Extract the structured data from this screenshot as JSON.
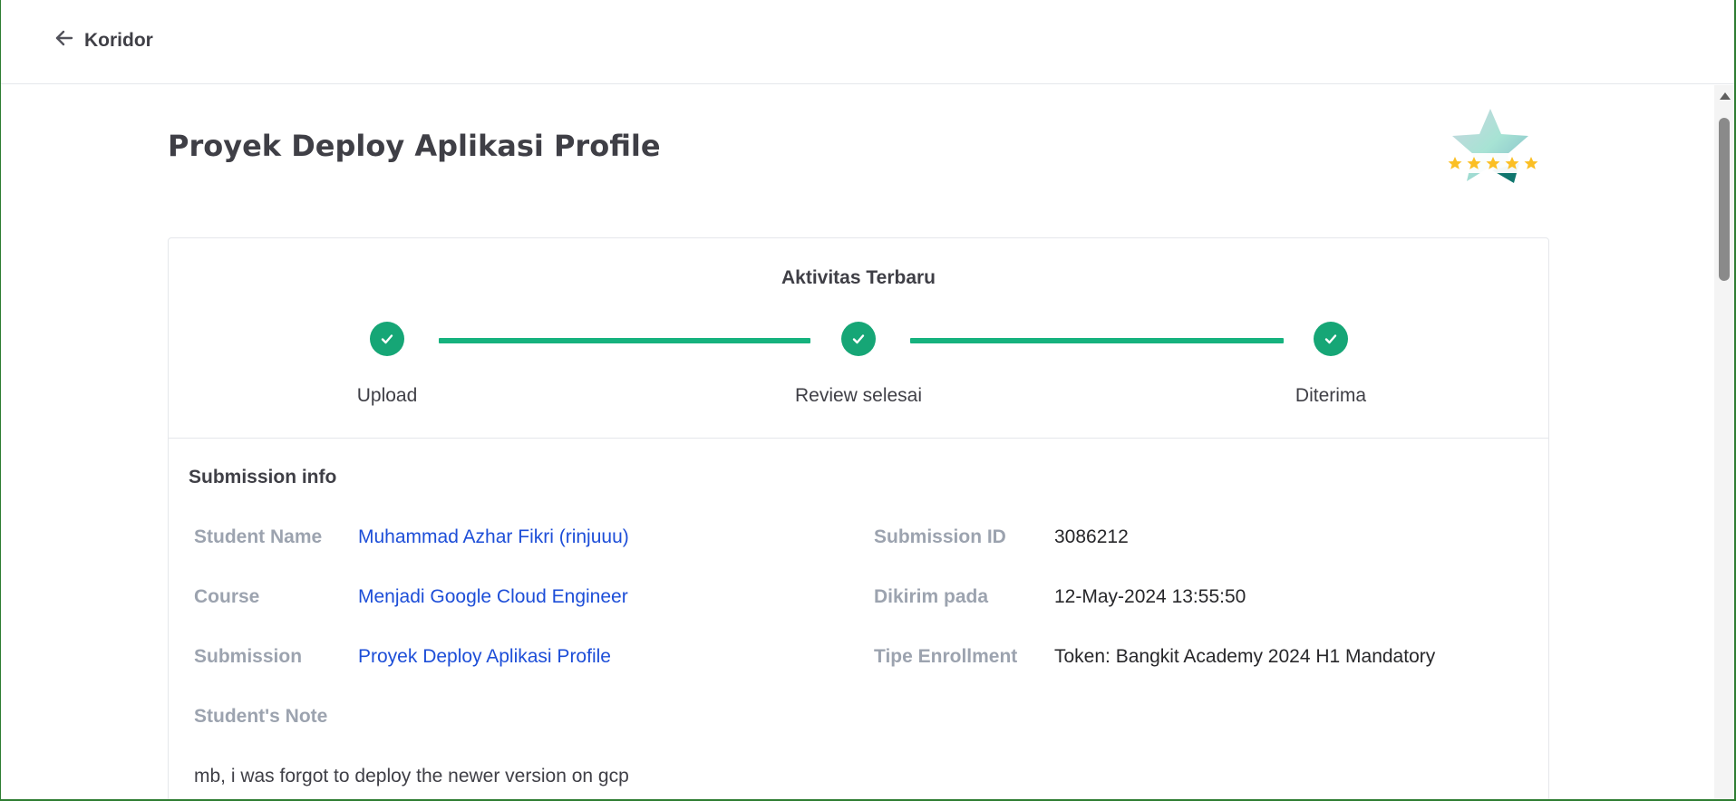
{
  "header": {
    "back_label": "Koridor"
  },
  "page": {
    "title": "Proyek Deploy Aplikasi Profile"
  },
  "activity": {
    "title": "Aktivitas Terbaru",
    "steps": [
      {
        "label": "Upload",
        "status": "done"
      },
      {
        "label": "Review selesai",
        "status": "done"
      },
      {
        "label": "Diterima",
        "status": "done"
      }
    ]
  },
  "submission": {
    "section_title": "Submission info",
    "student_name_label": "Student Name",
    "student_name": "Muhammad Azhar Fikri (rinjuuu)",
    "course_label": "Course",
    "course": "Menjadi Google Cloud Engineer",
    "submission_label": "Submission",
    "submission": "Proyek Deploy Aplikasi Profile",
    "note_label": "Student's Note",
    "note": "mb, i was forgot to deploy the newer version on gcp",
    "id_label": "Submission ID",
    "id": "3086212",
    "sent_label": "Dikirim pada",
    "sent": "12-May-2024 13:55:50",
    "enrollment_label": "Tipe Enrollment",
    "enrollment": "Token: Bangkit Academy 2024 H1 Mandatory"
  },
  "badge": {
    "icon": "five-star-rating-badge-icon",
    "stars": 5
  },
  "colors": {
    "success": "#16a676",
    "link": "#1d4ed8",
    "label": "#9ca3af",
    "star": "#fbbf24"
  }
}
